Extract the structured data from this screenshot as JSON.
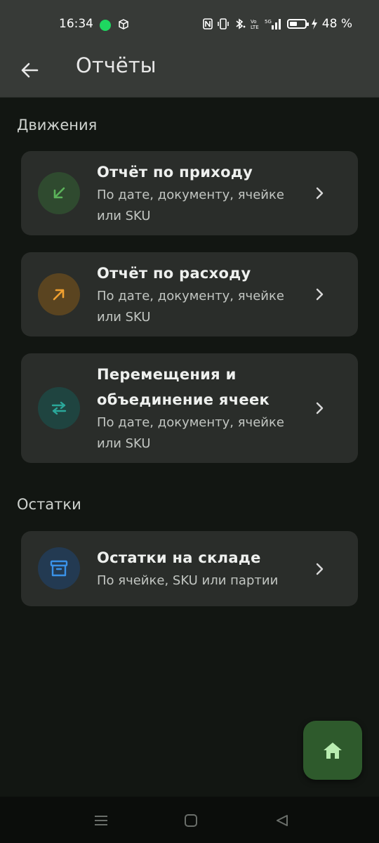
{
  "status_bar": {
    "time": "16:34",
    "battery_text": "48 %",
    "battery_level": 0.48
  },
  "app_bar": {
    "title": "Отчёты"
  },
  "sections": [
    {
      "label": "Движения",
      "items": [
        {
          "title": "Отчёт по приходу",
          "subtitle": "По дате, документу, ячейке или SKU",
          "icon": "arrow-down-left-icon",
          "icon_color": "#5bb35a",
          "icon_bg": "#2f4a2f"
        },
        {
          "title": "Отчёт по расходу",
          "subtitle": "По дате, документу, ячейке или SKU",
          "icon": "arrow-up-right-icon",
          "icon_color": "#f0a030",
          "icon_bg": "#5a4420"
        },
        {
          "title": "Перемещения и объединение ячеек",
          "subtitle": "По дате, документу, ячейке или SKU",
          "icon": "swap-arrows-icon",
          "icon_color": "#2aa89a",
          "icon_bg": "#1f4440"
        }
      ]
    },
    {
      "label": "Остатки",
      "items": [
        {
          "title": "Остатки на складе",
          "subtitle": "По ячейке, SKU или партии",
          "icon": "archive-box-icon",
          "icon_color": "#3a92e8",
          "icon_bg": "#233a52"
        }
      ]
    }
  ],
  "colors": {
    "background": "#121612",
    "card": "#2a2d2a",
    "app_bar": "#373a37",
    "fab": "#2e5a2c",
    "fab_icon": "#b8ecb0"
  },
  "fab": {
    "icon": "home-icon"
  },
  "nav": {
    "icons": [
      "recents-icon",
      "home-nav-icon",
      "back-nav-icon"
    ]
  }
}
